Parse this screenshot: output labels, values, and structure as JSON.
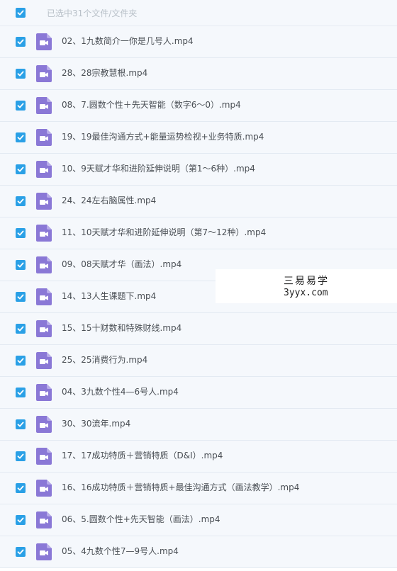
{
  "header": {
    "selection_label": "已选中31个文件/文件夹"
  },
  "colors": {
    "checkbox": "#2aa0e6",
    "video_icon": "#8a78d6",
    "row_bg": "#f5f8fc"
  },
  "icons": {
    "checkbox": "check-icon",
    "file": "video-file-icon"
  },
  "files": [
    {
      "name": "02、1九数简介一你是几号人.mp4",
      "checked": true
    },
    {
      "name": "28、28宗教慧根.mp4",
      "checked": true
    },
    {
      "name": "08、7.圆数个性＋先天智能（数字6～0）.mp4",
      "checked": true
    },
    {
      "name": "19、19最佳沟通方式+能量运势检视+业务特质.mp4",
      "checked": true
    },
    {
      "name": "10、9天赋才华和进阶延伸说明（第1～6种）.mp4",
      "checked": true
    },
    {
      "name": "24、24左右脑属性.mp4",
      "checked": true
    },
    {
      "name": "11、10天赋才华和进阶延伸说明（第7～12种）.mp4",
      "checked": true
    },
    {
      "name": "09、08天赋才华（画法）.mp4",
      "checked": true
    },
    {
      "name": "14、13人生课题下.mp4",
      "checked": true
    },
    {
      "name": "15、15十财数和特殊财线.mp4",
      "checked": true
    },
    {
      "name": "25、25消费行为.mp4",
      "checked": true
    },
    {
      "name": "04、3九数个性4—6号人.mp4",
      "checked": true
    },
    {
      "name": "30、30流年.mp4",
      "checked": true
    },
    {
      "name": "17、17成功特质＋营销特质（D&I）.mp4",
      "checked": true
    },
    {
      "name": "16、16成功特质＋营销特质+最佳沟通方式（画法教学）.mp4",
      "checked": true
    },
    {
      "name": "06、5.圆数个性+先天智能（画法）.mp4",
      "checked": true
    },
    {
      "name": "05、4九数个性7—9号人.mp4",
      "checked": true
    }
  ],
  "watermark": {
    "line1": "三易易学",
    "line2": "3yyx.com"
  }
}
